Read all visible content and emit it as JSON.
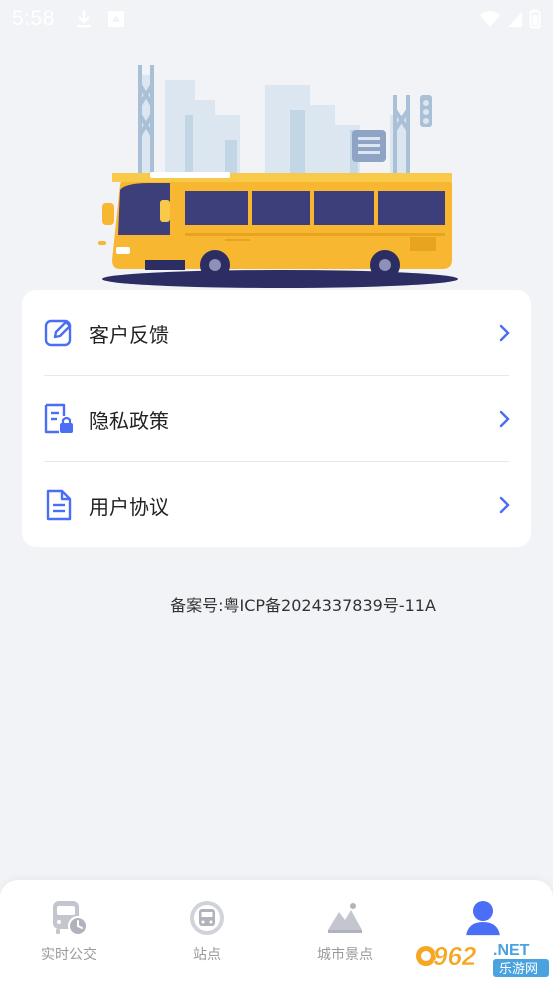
{
  "status_bar": {
    "time": "5:58"
  },
  "menu": {
    "items": [
      {
        "label": "客户反馈",
        "icon": "edit-feedback-icon"
      },
      {
        "label": "隐私政策",
        "icon": "privacy-lock-document-icon"
      },
      {
        "label": "用户协议",
        "icon": "document-icon"
      }
    ]
  },
  "icp": {
    "text": "备案号:粤ICP备2024337839号-11A"
  },
  "bottom_nav": {
    "items": [
      {
        "label": "实时公交",
        "icon": "realtime-bus-icon",
        "active": false
      },
      {
        "label": "站点",
        "icon": "bus-stop-icon",
        "active": false
      },
      {
        "label": "城市景点",
        "icon": "city-scenery-icon",
        "active": false
      },
      {
        "label": "",
        "icon": "profile-icon",
        "active": true
      }
    ]
  },
  "watermark": {
    "text_962": "962",
    "text_net": ".NET",
    "text_cn": "乐游网"
  },
  "colors": {
    "accent": "#4a6ef5",
    "bus_yellow": "#f7b731",
    "inactive": "#b8bbc4",
    "background": "#f2f3f7"
  }
}
